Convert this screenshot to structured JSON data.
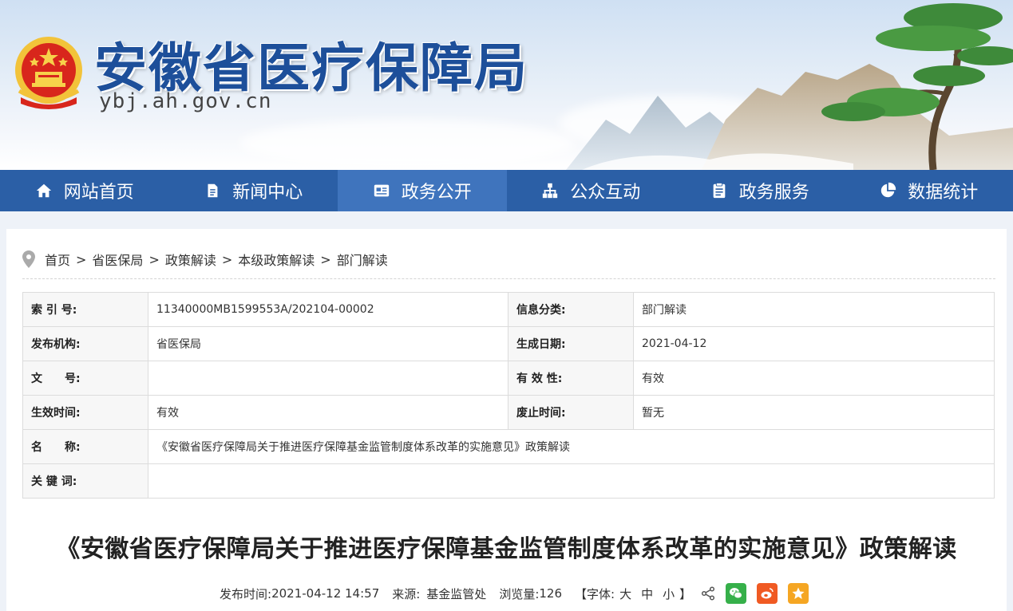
{
  "header": {
    "site_name": "安徽省医疗保障局",
    "site_url": "ybj.ah.gov.cn"
  },
  "nav": {
    "items": [
      {
        "label": "网站首页",
        "icon": "home-icon"
      },
      {
        "label": "新闻中心",
        "icon": "document-icon"
      },
      {
        "label": "政务公开",
        "icon": "news-list-icon",
        "active": true
      },
      {
        "label": "公众互动",
        "icon": "org-chart-icon"
      },
      {
        "label": "政务服务",
        "icon": "clipboard-icon"
      },
      {
        "label": "数据统计",
        "icon": "pie-chart-icon"
      }
    ]
  },
  "breadcrumb": {
    "items": [
      "首页",
      "省医保局",
      "政策解读",
      "本级政策解读",
      "部门解读"
    ],
    "separator": ">"
  },
  "meta": {
    "index_label": "索 引 号:",
    "index_value": "11340000MB1599553A/202104-00002",
    "category_label": "信息分类:",
    "category_value": "部门解读",
    "publisher_label": "发布机构:",
    "publisher_value": "省医保局",
    "created_label": "生成日期:",
    "created_value": "2021-04-12",
    "docno_label": "文　　号:",
    "docno_value": "",
    "validity_label": "有 效 性:",
    "validity_value": "有效",
    "effective_label": "生效时间:",
    "effective_value": "有效",
    "expire_label": "废止时间:",
    "expire_value": "暂无",
    "name_label": "名　　称:",
    "name_value": "《安徽省医疗保障局关于推进医疗保障基金监管制度体系改革的实施意见》政策解读",
    "keywords_label": "关 键 词:",
    "keywords_value": ""
  },
  "article": {
    "title": "《安徽省医疗保障局关于推进医疗保障基金监管制度体系改革的实施意见》政策解读",
    "publish_label": "发布时间:",
    "publish_time": "2021-04-12 14:57",
    "source_label": "来源:",
    "source": "基金监管处",
    "views_label": "浏览量:",
    "views": "126",
    "font_open": "【字体:",
    "font_large": "大",
    "font_medium": "中",
    "font_small": "小",
    "font_close": "】"
  },
  "share": {
    "icons": [
      "share-icon",
      "wechat-icon",
      "weibo-icon",
      "favorite-icon"
    ],
    "colors": {
      "wechat": "#36b04a",
      "weibo": "#f05a23",
      "favorite": "#f5a623"
    }
  },
  "colors": {
    "nav_bg": "#2b5fa6",
    "nav_active": "#3f74bd",
    "brand_blue": "#1d4f9a"
  }
}
